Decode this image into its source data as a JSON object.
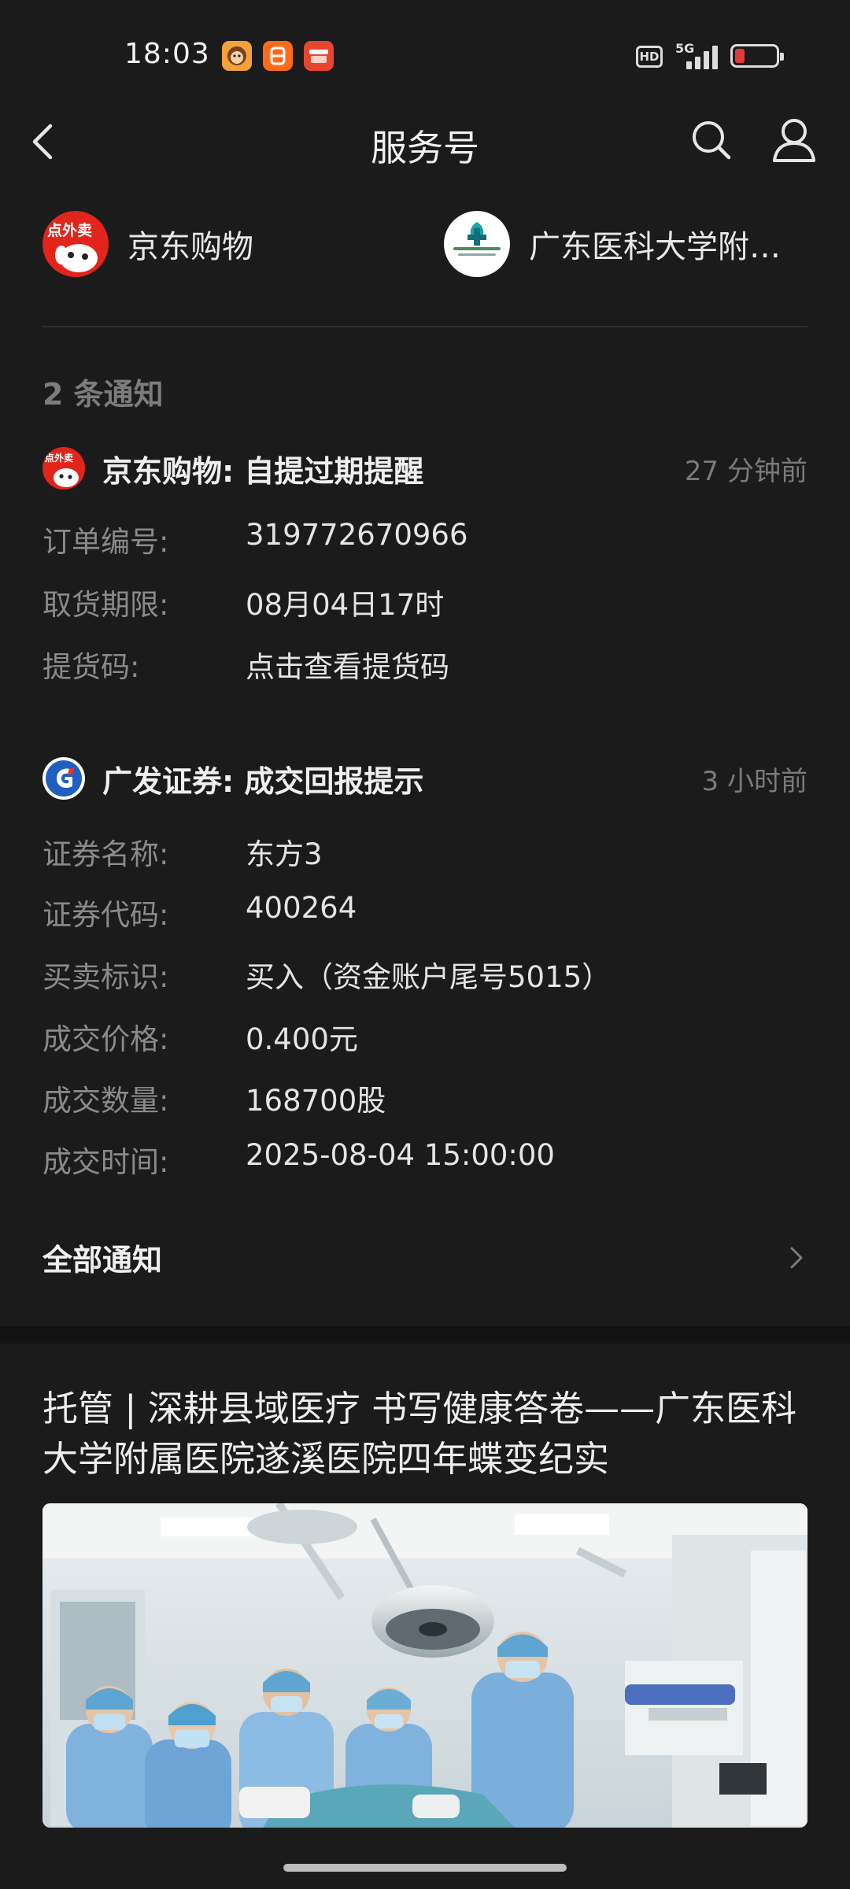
{
  "status_bar": {
    "time": "18:03",
    "icons": [
      "monkey-app-icon",
      "orange-app-icon",
      "red-app-icon"
    ],
    "network": "5G",
    "hd": "HD",
    "battery_level": 0.1
  },
  "header": {
    "title": "服务号"
  },
  "accounts": [
    {
      "name": "京东购物",
      "avatar_text": "点外卖"
    },
    {
      "name": "广东医科大学附…"
    }
  ],
  "notifications": {
    "count_text": "2 条通知",
    "items": [
      {
        "title": "京东购物: 自提过期提醒",
        "time": "27 分钟前",
        "avatar_text": "点外卖",
        "fields": [
          {
            "label": "订单编号:",
            "value": "319772670966"
          },
          {
            "label": "取货期限:",
            "value": "08月04日17时"
          },
          {
            "label": "提货码:",
            "value": "点击查看提货码"
          }
        ]
      },
      {
        "title": "广发证券: 成交回报提示",
        "time": "3 小时前",
        "fields": [
          {
            "label": "证券名称:",
            "value": "东方3"
          },
          {
            "label": "证券代码:",
            "value": "400264"
          },
          {
            "label": "买卖标识:",
            "value": "买入（资金账户尾号5015）"
          },
          {
            "label": "成交价格:",
            "value": "0.400元"
          },
          {
            "label": "成交数量:",
            "value": "168700股"
          },
          {
            "label": "成交时间:",
            "value": "2025-08-04 15:00:00"
          }
        ]
      }
    ],
    "all_label": "全部通知"
  },
  "article": {
    "title": "托管 | 深耕县域医疗 书写健康答卷——广东医科大学附属医院遂溪医院四年蝶变纪实"
  },
  "colors": {
    "background": "#1b1b1b",
    "separator": "#121212",
    "jd_red": "#e1251b",
    "gf_blue": "#1f5fbf"
  }
}
